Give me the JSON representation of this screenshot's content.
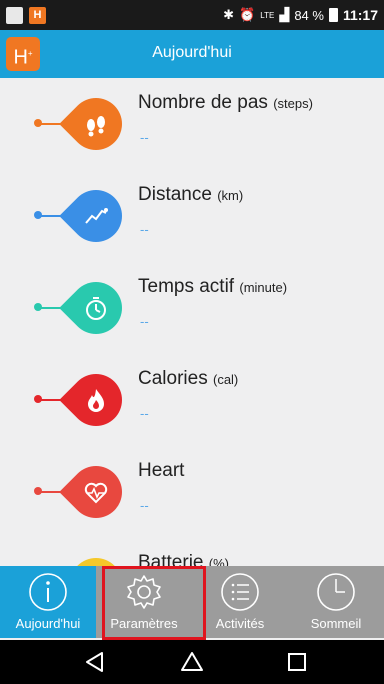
{
  "status_bar": {
    "network": "LTE",
    "battery": "84 %",
    "time": "11:17",
    "app_badge": "H"
  },
  "header": {
    "logo": "H",
    "title": "Aujourd'hui"
  },
  "metrics": [
    {
      "title": "Nombre de pas",
      "unit": "(steps)",
      "value": "--",
      "color": "#f07722",
      "icon": "footprints-icon"
    },
    {
      "title": "Distance",
      "unit": "(km)",
      "value": "--",
      "color": "#3a8fe6",
      "icon": "distance-graph-icon"
    },
    {
      "title": "Temps actif",
      "unit": "(minute)",
      "value": "--",
      "color": "#29c9ae",
      "icon": "stopwatch-icon"
    },
    {
      "title": "Calories",
      "unit": "(cal)",
      "value": "--",
      "color": "#e4262b",
      "icon": "flame-icon"
    },
    {
      "title": "Heart",
      "unit": "",
      "value": "--",
      "color": "#e8483f",
      "icon": "heart-pulse-icon"
    },
    {
      "title": "Batterie",
      "unit": "(%)",
      "value": "",
      "color": "#f5c82a",
      "icon": "battery-icon"
    }
  ],
  "tabs": [
    {
      "label": "Aujourd'hui",
      "icon": "info-icon",
      "active": true
    },
    {
      "label": "Paramètres",
      "icon": "gear-icon",
      "active": false
    },
    {
      "label": "Activités",
      "icon": "list-icon",
      "active": false
    },
    {
      "label": "Sommeil",
      "icon": "clock-icon",
      "active": false
    }
  ],
  "colors": {
    "accent": "#1ba1d8",
    "brand": "#f07722",
    "tab_bar": "#9c9c9c",
    "highlight": "#e0141e",
    "value_text": "#5aa8e8"
  }
}
